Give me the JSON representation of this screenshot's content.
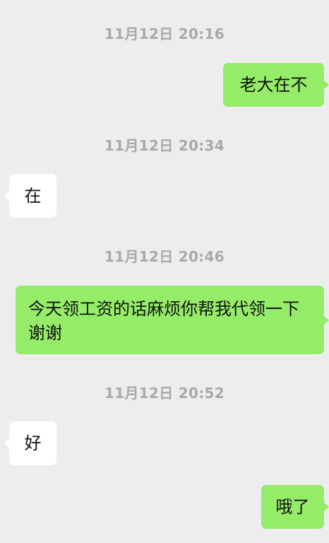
{
  "messages": [
    {
      "time": "11月12日 20:16",
      "text": "老大在不",
      "direction": "outgoing"
    },
    {
      "time": "11月12日 20:34",
      "text": "在",
      "direction": "incoming"
    },
    {
      "time": "11月12日 20:46",
      "text": "今天领工资的话麻烦你帮我代领一下谢谢",
      "direction": "outgoing"
    },
    {
      "time": "11月12日 20:52",
      "text": "好",
      "direction": "incoming"
    },
    {
      "time": "",
      "text": "哦了",
      "direction": "outgoing"
    }
  ],
  "colors": {
    "background": "#ededed",
    "outgoing_bubble": "#95ec69",
    "incoming_bubble": "#ffffff",
    "timestamp": "#a9a9a9"
  }
}
